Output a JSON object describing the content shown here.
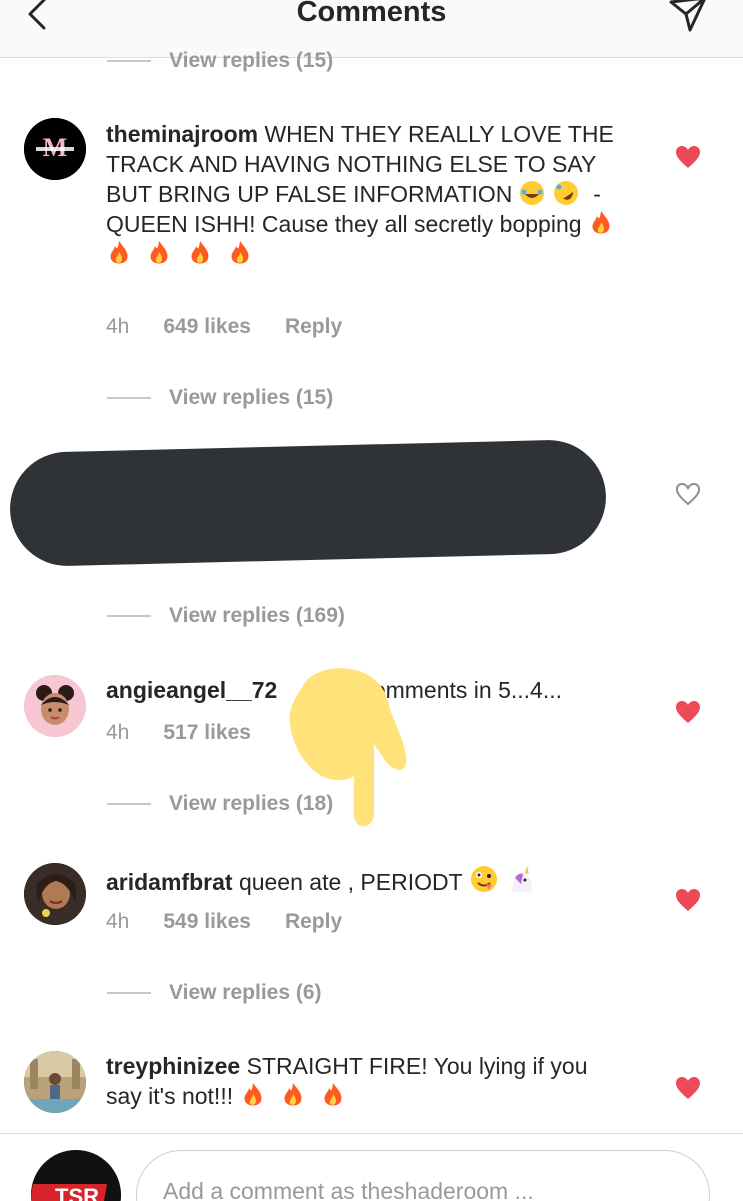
{
  "header": {
    "title": "Comments"
  },
  "colors": {
    "heart": "#ed4956",
    "muted": "#999999",
    "text": "#262626"
  },
  "top_view_replies": "View replies (15)",
  "comments": [
    {
      "username": "theminajroom",
      "text": "WHEN THEY REALLY LOVE THE TRACK AND HAVING NOTHING ELSE TO SAY BUT BRING UP FALSE INFORMATION",
      "text2": "- QUEEN ISHH! Cause they all secretly bopping",
      "time": "4h",
      "likes": "649 likes",
      "reply": "Reply",
      "liked": true,
      "view_replies": "View replies (15)"
    },
    {
      "username": "",
      "text": "",
      "liked": false,
      "view_replies": "View replies (169)"
    },
    {
      "username": "angieangel__72",
      "text": "comments in 5...4...",
      "time": "4h",
      "likes": "517 likes",
      "liked": true,
      "view_replies": "View replies (18)"
    },
    {
      "username": "aridamfbrat",
      "text": "queen ate , PERIODT",
      "time": "4h",
      "likes": "549 likes",
      "reply": "Reply",
      "liked": true,
      "view_replies": "View replies (6)"
    },
    {
      "username": "treyphinizee",
      "text": "STRAIGHT FIRE! You lying if you say it's not!!!",
      "liked": true
    }
  ],
  "composer": {
    "avatar_label": "TSR",
    "placeholder": "Add a comment as theshaderoom ..."
  }
}
